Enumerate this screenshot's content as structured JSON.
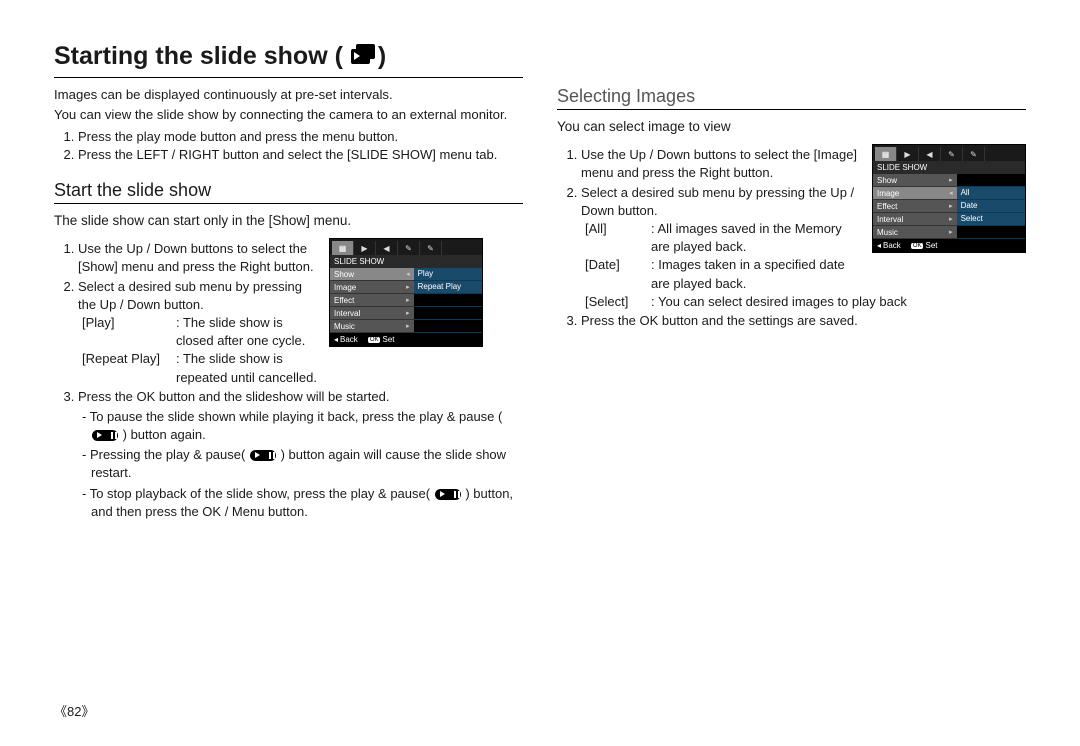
{
  "page_title": "Starting the slide show (",
  "page_title_tail": ")",
  "left": {
    "intro1": "Images can be displayed continuously at pre-set intervals.",
    "intro2": "You can view the slide show by connecting the camera to an external monitor.",
    "steps_top": [
      "Press the play mode button and press the menu button.",
      "Press the LEFT / RIGHT button and select the [SLIDE SHOW] menu tab."
    ],
    "section_title": "Start the slide show",
    "section_intro": "The slide show can start only in the [Show] menu.",
    "steps_main": [
      "Use the Up / Down buttons to select the [Show] menu and press the Right button.",
      "Select a desired sub menu by pressing the Up / Down button.",
      "Press the OK button and the slideshow will be started."
    ],
    "defs": [
      {
        "term": "[Play]",
        "desc": ": The slide show is closed after one cycle."
      },
      {
        "term": "[Repeat Play]",
        "desc": ": The slide show is repeated until cancelled."
      }
    ],
    "bullets": [
      "To pause the slide shown while playing it back, press the play & pause (",
      ") button again.",
      "Pressing the play & pause(",
      ") button again will cause the slide show restart.",
      "To stop playback of the slide show, press the play & pause(",
      ") button, and then press the OK / Menu  button."
    ]
  },
  "right": {
    "section_title": "Selecting  Images",
    "section_intro": "You can select image to view",
    "steps": [
      "Use the Up / Down buttons to select the [Image] menu and press the Right button.",
      "Select a desired sub menu by pressing the Up / Down button.",
      "Press the OK button and the settings are saved."
    ],
    "defs": [
      {
        "term": "[All]",
        "desc": ": All images saved in the Memory are played back."
      },
      {
        "term": "[Date]",
        "desc": ": Images taken in a specified date are played back."
      },
      {
        "term": "[Select]",
        "desc": ": You can select desired images to play back"
      }
    ]
  },
  "osd_left": {
    "title": "SLIDE SHOW",
    "rows": [
      {
        "l": "Show",
        "r": "Play",
        "sel": true
      },
      {
        "l": "Image",
        "r": "Repeat Play",
        "sel": false
      },
      {
        "l": "Effect",
        "r": "",
        "sel": false
      },
      {
        "l": "Interval",
        "r": "",
        "sel": false
      },
      {
        "l": "Music",
        "r": "",
        "sel": false
      }
    ],
    "back": "Back",
    "set": "Set"
  },
  "osd_right": {
    "title": "SLIDE SHOW",
    "rows": [
      {
        "l": "Show",
        "r": "",
        "sel": false
      },
      {
        "l": "Image",
        "r": "All",
        "sel": true
      },
      {
        "l": "Effect",
        "r": "Date",
        "sel": false
      },
      {
        "l": "Interval",
        "r": "Select",
        "sel": false
      },
      {
        "l": "Music",
        "r": "",
        "sel": false
      }
    ],
    "back": "Back",
    "set": "Set"
  },
  "page_number": "《82》"
}
